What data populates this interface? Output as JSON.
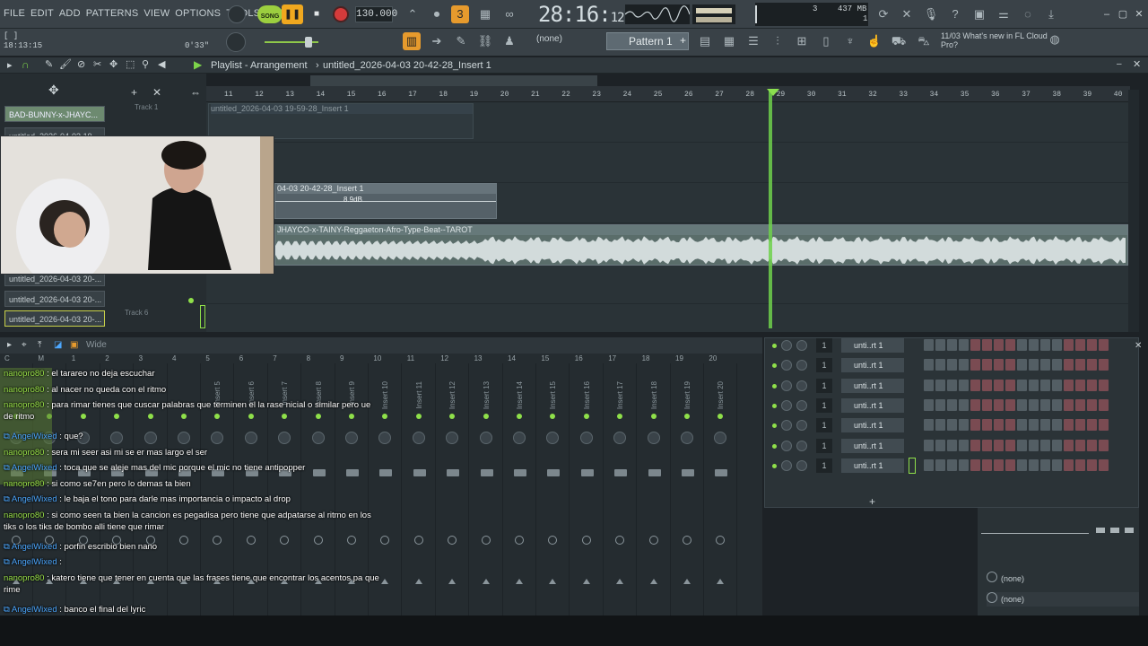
{
  "menu": [
    "FILE",
    "EDIT",
    "ADD",
    "PATTERNS",
    "VIEW",
    "OPTIONS",
    "TOOLS",
    "HELP"
  ],
  "transport": {
    "song_label": "SONG",
    "play_icon": "pause-icon",
    "tempo": "130.000"
  },
  "time_display": {
    "main": "28:16:",
    "sub": "12"
  },
  "cpu": {
    "value_a": "3",
    "memory": "437 MB",
    "value_b": "1"
  },
  "hint": {
    "line1": "[ ]",
    "time": "18:13:15",
    "position": "0'33\""
  },
  "pattern": {
    "none": "(none)",
    "name": "Pattern 1"
  },
  "news": {
    "date": "11/03",
    "text": "What's new in FL Cloud Pro?"
  },
  "playlist": {
    "title": "Playlist - Arrangement",
    "arrangement": "untitled_2026-04-03 20-42-28_Insert 1",
    "ruler": [
      "11",
      "12",
      "13",
      "14",
      "15",
      "16",
      "17",
      "18",
      "19",
      "20",
      "21",
      "22",
      "23",
      "24",
      "25",
      "26",
      "27",
      "28",
      "29",
      "30",
      "31",
      "32",
      "33",
      "34",
      "35",
      "36",
      "37",
      "38",
      "39",
      "40"
    ],
    "track_list": [
      "BAD-BUNNY-x-JHAYC...",
      "untitled_2026-04-03 19-...",
      "untitled_2026-04-03 20-...",
      "untitled_2026-04-03 20-...",
      "untitled_2026-04-03 20-..."
    ],
    "track_labels": [
      "Track 1",
      "Track 6"
    ],
    "clip1": "untitled_2026-04-03 19-59-28_Insert 1",
    "clip2": "04-03 20-42-28_Insert 1",
    "clip2_gain": "8.9dB",
    "clip3": "JHAYCO-x-TAINY-Reggaeton-Afro-Type-Beat--TAROT"
  },
  "mixer": {
    "view": "Wide",
    "inserts": [
      "Insert 5",
      "Insert 6",
      "Insert 7",
      "Insert 8",
      "Insert 9",
      "Insert 10",
      "Insert 11",
      "Insert 12",
      "Insert 13",
      "Insert 14",
      "Insert 15",
      "Insert 16",
      "Insert 17",
      "Insert 18",
      "Insert 19",
      "Insert 20"
    ],
    "numbers": [
      "C",
      "M",
      "1",
      "2",
      "3",
      "4",
      "5",
      "6",
      "7",
      "8",
      "9",
      "10",
      "11",
      "12",
      "13",
      "14",
      "15",
      "16",
      "17",
      "18",
      "19",
      "20"
    ]
  },
  "chat": [
    {
      "user": "nanopro80",
      "text": "el tarareo no deja escuchar",
      "lines": 1,
      "u": "u1"
    },
    {
      "user": "nanopro80",
      "text": "al nacer no queda con el ritmo",
      "lines": 1,
      "u": "u1"
    },
    {
      "user": "nanopro80",
      "text": "para rimar tienes que cuscar palabras que terminen el la rase nicial o similar pero ue de ritmo",
      "lines": 2,
      "u": "u1"
    },
    {
      "user": "AngelWixed",
      "text": "que?",
      "lines": 1,
      "u": "u2"
    },
    {
      "user": "nanopro80",
      "text": "sera mi seer asi mi se er mas largo el ser",
      "lines": 1,
      "u": "u1"
    },
    {
      "user": "AngelWixed",
      "text": "toca que se aleje mas del mic porque el mic no tiene antipopper",
      "lines": 1,
      "u": "u2"
    },
    {
      "user": "nanopro80",
      "text": "si como se7en pero lo demas ta bien",
      "lines": 1,
      "u": "u1"
    },
    {
      "user": "AngelWixed",
      "text": "le baja el tono para darle mas importancia o impacto al drop",
      "lines": 1,
      "u": "u2"
    },
    {
      "user": "nanopro80",
      "text": "si como seen ta bien la cancion es pegadisa pero tiene que adpatarse al ritmo en los tiks o los tiks de bombo alli tiene que rimar",
      "lines": 2,
      "u": "u1"
    },
    {
      "user": "AngelWixed",
      "text": "porfin escribio bien nano",
      "lines": 1,
      "u": "u2"
    },
    {
      "user": "AngelWixed",
      "text": "",
      "lines": 1,
      "u": "u2"
    },
    {
      "user": "nanopro80",
      "text": "katero tiene que tener en cuenta que las frases tiene que encontrar los acentos pa que rime",
      "lines": 2,
      "u": "u1"
    },
    {
      "user": "AngelWixed",
      "text": "banco el final del lyric",
      "lines": 1,
      "u": "u2"
    }
  ],
  "rack": {
    "channels": [
      {
        "num": "1",
        "name": "unti..rt 1"
      },
      {
        "num": "1",
        "name": "unti..rt 1"
      },
      {
        "num": "1",
        "name": "unti..rt 1"
      },
      {
        "num": "1",
        "name": "unti..rt 1"
      },
      {
        "num": "1",
        "name": "unti..rt 1"
      },
      {
        "num": "1",
        "name": "unti..rt 1"
      },
      {
        "num": "1",
        "name": "unti..rt 1"
      }
    ],
    "add": "+"
  },
  "slots": {
    "a": "(none)",
    "b": "(none)"
  },
  "colors": {
    "accent": "#9ccf3f",
    "play": "#f0a81f",
    "record": "#d43b3b",
    "playhead": "#6fd14b",
    "user_nano": "#9be34a",
    "user_angel": "#4da8ff"
  }
}
